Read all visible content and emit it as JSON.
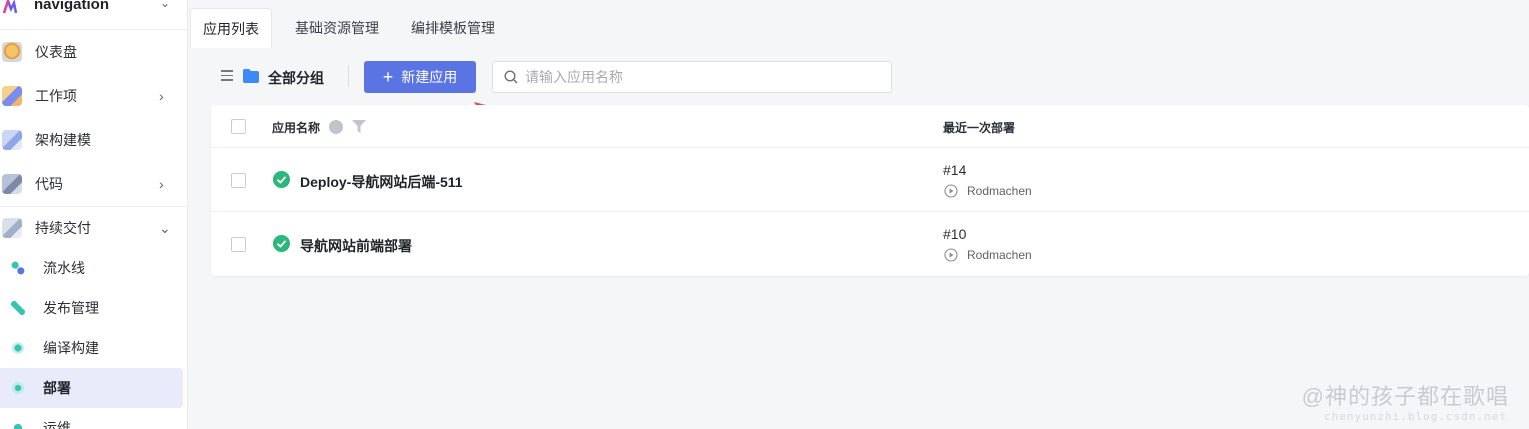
{
  "sidebar": {
    "header_title": "navigation",
    "items": [
      {
        "label": "仪表盘",
        "icon": "dashboard-icon"
      },
      {
        "label": "工作项",
        "icon": "workitem-icon",
        "expandable": true
      },
      {
        "label": "架构建模",
        "icon": "architecture-icon"
      },
      {
        "label": "代码",
        "icon": "code-icon",
        "expandable": true
      },
      {
        "label": "持续交付",
        "icon": "delivery-icon",
        "expanded": true
      }
    ],
    "sub_items": [
      {
        "label": "流水线",
        "icon": "pipeline-icon"
      },
      {
        "label": "发布管理",
        "icon": "release-icon"
      },
      {
        "label": "编译构建",
        "icon": "build-icon"
      },
      {
        "label": "部署",
        "icon": "deploy-icon",
        "active": true
      },
      {
        "label": "运维",
        "icon": "ops-icon"
      }
    ]
  },
  "tabs": [
    {
      "label": "应用列表",
      "active": true
    },
    {
      "label": "基础资源管理"
    },
    {
      "label": "编排模板管理"
    }
  ],
  "toolbar": {
    "group_label": "全部分组",
    "new_button_label": "新建应用",
    "search_placeholder": "请输入应用名称"
  },
  "table": {
    "columns": {
      "name": "应用名称",
      "last_deploy": "最近一次部署"
    },
    "rows": [
      {
        "name": "Deploy-导航网站后端-511",
        "status": "success",
        "deploy_num": "#14",
        "deployer": "Rodmachen"
      },
      {
        "name": "导航网站前端部署",
        "status": "success",
        "deploy_num": "#10",
        "deployer": "Rodmachen"
      }
    ]
  },
  "watermark": {
    "text": "@神的孩子都在歌唱",
    "sub": "chenyunzhi.blog.csdn.net"
  },
  "colors": {
    "primary": "#5b74e4",
    "success": "#2eb67d",
    "annotation_arrow": "#d9534f",
    "active_bg": "#e8ecfa"
  }
}
